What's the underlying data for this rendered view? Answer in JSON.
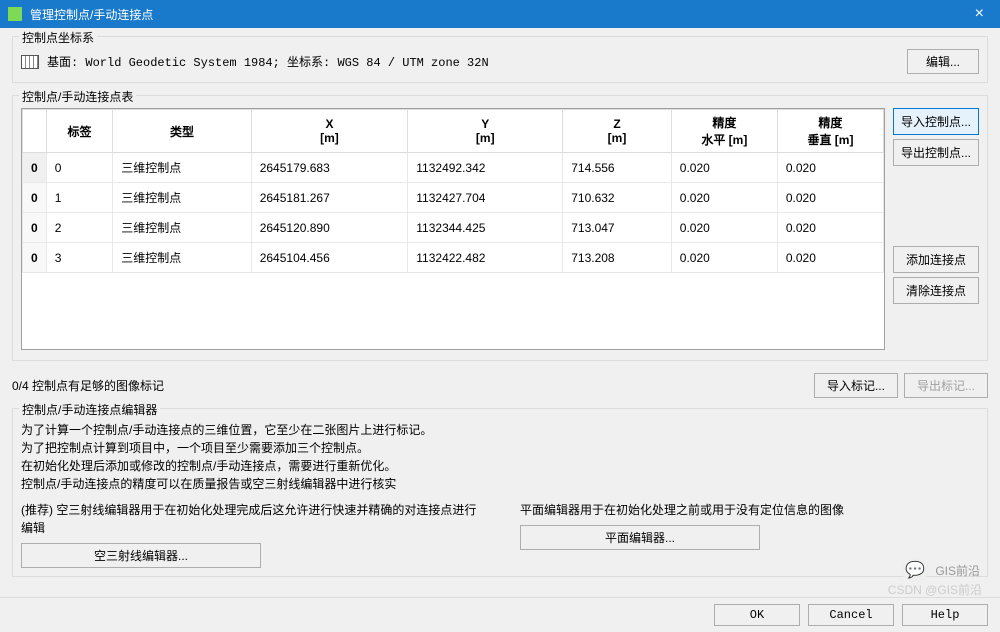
{
  "dialog": {
    "title": "管理控制点/手动连接点",
    "close_glyph": "×"
  },
  "crs_group": {
    "label": "控制点坐标系",
    "text": "基面: World Geodetic System 1984; 坐标系: WGS 84 / UTM zone 32N",
    "edit_btn": "编辑..."
  },
  "table_group": {
    "label": "控制点/手动连接点表",
    "headers": {
      "tag": "标签",
      "type": "类型",
      "x": "X",
      "x_sub": "[m]",
      "y": "Y",
      "y_sub": "[m]",
      "z": "Z",
      "z_sub": "[m]",
      "acc_h": "精度",
      "acc_h_sub": "水平 [m]",
      "acc_v": "精度",
      "acc_v_sub": "垂直 [m]"
    },
    "rows": [
      {
        "idx": "0",
        "tag": "0",
        "type": "三维控制点",
        "x": "2645179.683",
        "y": "1132492.342",
        "z": "714.556",
        "ah": "0.020",
        "av": "0.020"
      },
      {
        "idx": "0",
        "tag": "1",
        "type": "三维控制点",
        "x": "2645181.267",
        "y": "1132427.704",
        "z": "710.632",
        "ah": "0.020",
        "av": "0.020"
      },
      {
        "idx": "0",
        "tag": "2",
        "type": "三维控制点",
        "x": "2645120.890",
        "y": "1132344.425",
        "z": "713.047",
        "ah": "0.020",
        "av": "0.020"
      },
      {
        "idx": "0",
        "tag": "3",
        "type": "三维控制点",
        "x": "2645104.456",
        "y": "1132422.482",
        "z": "713.208",
        "ah": "0.020",
        "av": "0.020"
      }
    ],
    "side_buttons": {
      "import_cp": "导入控制点...",
      "export_cp": "导出控制点...",
      "add_tie": "添加连接点",
      "clear_tie": "清除连接点"
    }
  },
  "marker": {
    "status": "0/4 控制点有足够的图像标记",
    "import_marks": "导入标记...",
    "export_marks": "导出标记..."
  },
  "editor_group": {
    "label": "控制点/手动连接点编辑器",
    "help1": "为了计算一个控制点/手动连接点的三维位置，它至少在二张图片上进行标记。",
    "help2": "为了把控制点计算到项目中，一个项目至少需要添加三个控制点。",
    "help3": "在初始化处理后添加或修改的控制点/手动连接点，需要进行重新优化。",
    "help4": "控制点/手动连接点的精度可以在质量报告或空三射线编辑器中进行核实",
    "left_text": "(推荐) 空三射线编辑器用于在初始化处理完成后这允许进行快速并精确的对连接点进行编辑",
    "left_btn": "空三射线编辑器...",
    "right_text": "平面编辑器用于在初始化处理之前或用于没有定位信息的图像",
    "right_btn": "平面编辑器..."
  },
  "footer": {
    "ok": "OK",
    "cancel": "Cancel",
    "help": "Help"
  },
  "watermark": {
    "text": "GIS前沿",
    "sub": "CSDN @GIS前沿"
  }
}
